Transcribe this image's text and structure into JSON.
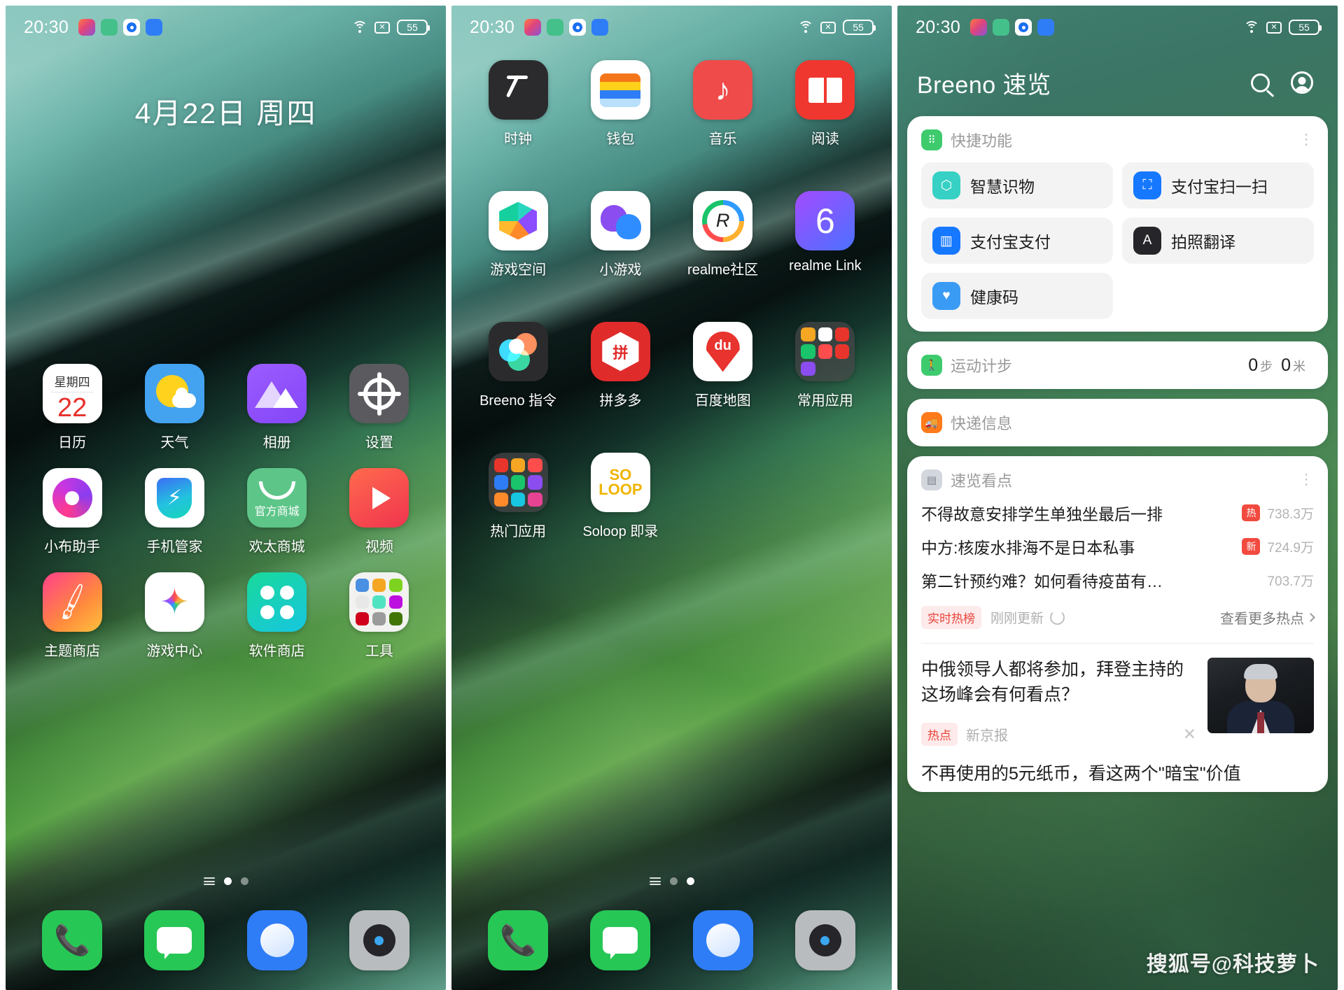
{
  "status_bar": {
    "time": "20:30",
    "battery": "55",
    "wifi_icon": "wifi-icon",
    "signal_icon": "no-signal-icon",
    "battery_icon": "battery-icon",
    "notification_icons": [
      "photos-notification-icon",
      "health-notification-icon",
      "breeno-notification-icon",
      "weather-notification-icon"
    ]
  },
  "panel1": {
    "date": "4月22日 周四",
    "apps": [
      {
        "label": "日历",
        "icon": "calendar-icon",
        "weekday": "星期四",
        "day": "22"
      },
      {
        "label": "天气",
        "icon": "weather-icon"
      },
      {
        "label": "相册",
        "icon": "album-icon"
      },
      {
        "label": "设置",
        "icon": "settings-icon"
      },
      {
        "label": "小布助手",
        "icon": "breeno-assistant-icon"
      },
      {
        "label": "手机管家",
        "icon": "phone-manager-icon"
      },
      {
        "label": "欢太商城",
        "icon": "heytap-store-icon",
        "tag": "官方商城"
      },
      {
        "label": "视频",
        "icon": "video-icon"
      },
      {
        "label": "主题商店",
        "icon": "theme-store-icon"
      },
      {
        "label": "游戏中心",
        "icon": "game-center-icon"
      },
      {
        "label": "软件商店",
        "icon": "app-market-icon"
      },
      {
        "label": "工具",
        "icon": "tools-folder-icon"
      }
    ],
    "page_dots": {
      "count": 2,
      "active": 0
    },
    "dock": [
      {
        "label": "电话",
        "icon": "phone-icon"
      },
      {
        "label": "信息",
        "icon": "messages-icon"
      },
      {
        "label": "浏览器",
        "icon": "browser-icon"
      },
      {
        "label": "相机",
        "icon": "camera-icon"
      }
    ]
  },
  "panel2": {
    "apps": [
      {
        "label": "时钟",
        "icon": "clock-icon"
      },
      {
        "label": "钱包",
        "icon": "wallet-icon"
      },
      {
        "label": "音乐",
        "icon": "music-icon"
      },
      {
        "label": "阅读",
        "icon": "reading-icon"
      },
      {
        "label": "游戏空间",
        "icon": "game-space-icon"
      },
      {
        "label": "小游戏",
        "icon": "mini-games-icon"
      },
      {
        "label": "realme社区",
        "icon": "realme-community-icon"
      },
      {
        "label": "realme Link",
        "icon": "realme-link-icon"
      },
      {
        "label": "Breeno 指令",
        "icon": "breeno-command-icon"
      },
      {
        "label": "拼多多",
        "icon": "pinduoduo-icon"
      },
      {
        "label": "百度地图",
        "icon": "baidu-map-icon"
      },
      {
        "label": "常用应用",
        "icon": "common-apps-folder-icon"
      },
      {
        "label": "热门应用",
        "icon": "hot-apps-folder-icon"
      },
      {
        "label": "Soloop 即录",
        "icon": "soloop-icon"
      }
    ],
    "page_dots": {
      "count": 2,
      "active": 1
    },
    "dock": [
      {
        "label": "电话",
        "icon": "phone-icon"
      },
      {
        "label": "信息",
        "icon": "messages-icon"
      },
      {
        "label": "浏览器",
        "icon": "browser-icon"
      },
      {
        "label": "相机",
        "icon": "camera-icon"
      }
    ]
  },
  "panel3": {
    "title": "Breeno 速览",
    "search_icon": "search-icon",
    "account_icon": "account-icon",
    "quick_functions": {
      "title": "快捷功能",
      "menu_icon": "more-options-icon",
      "header_icon": "quick-functions-icon",
      "items": [
        {
          "label": "智慧识物",
          "icon": "object-recognition-icon"
        },
        {
          "label": "支付宝扫一扫",
          "icon": "alipay-scan-icon"
        },
        {
          "label": "支付宝支付",
          "icon": "alipay-pay-icon"
        },
        {
          "label": "拍照翻译",
          "icon": "photo-translate-icon"
        },
        {
          "label": "健康码",
          "icon": "health-code-icon"
        }
      ]
    },
    "steps_card": {
      "title": "运动计步",
      "icon": "walking-icon",
      "steps": "0",
      "steps_unit": "步",
      "distance": "0",
      "distance_unit": "米"
    },
    "delivery_card": {
      "title": "快递信息",
      "icon": "delivery-truck-icon"
    },
    "news_card": {
      "title": "速览看点",
      "icon": "news-icon",
      "menu_icon": "more-options-icon",
      "headlines": [
        {
          "title": "不得故意安排学生单独坐最后一排",
          "badge": "热",
          "count": "738.3万"
        },
        {
          "title": "中方:核废水排海不是日本私事",
          "badge": "新",
          "count": "724.9万"
        },
        {
          "title": "第二针预约难？如何看待疫苗有…",
          "badge": "",
          "count": "703.7万"
        }
      ],
      "hot_list_pill": "实时热榜",
      "updated_text": "刚刚更新",
      "refresh_icon": "refresh-icon",
      "more_label": "查看更多热点",
      "more_chevron": "chevron-right-icon",
      "feature": {
        "title": "中俄领导人都将参加，拜登主持的这场峰会有何看点？",
        "badge": "热点",
        "source": "新京报",
        "close_icon": "close-icon",
        "thumbnail": "politician-portrait"
      },
      "next_headline": "不再使用的5元纸币，看这两个\"暗宝\"价值"
    }
  },
  "watermark": "搜狐号@科技萝卜"
}
